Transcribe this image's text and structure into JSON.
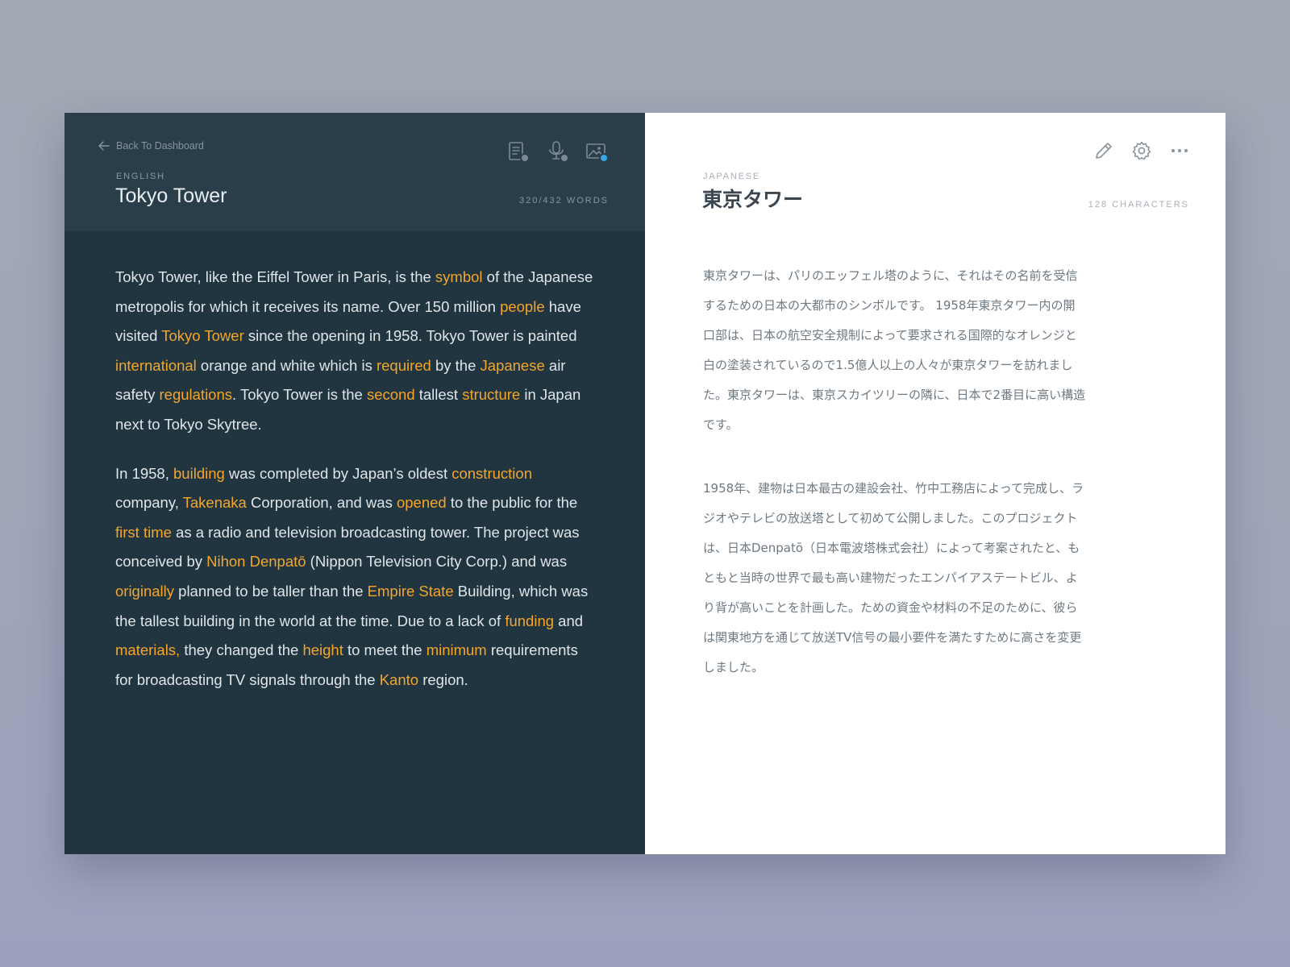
{
  "source": {
    "back_label": "Back To Dashboard",
    "language": "English",
    "title": "Tokyo Tower",
    "word_count": "320/432 WORDS",
    "tools": [
      {
        "icon": "document-check-icon",
        "badge": "check"
      },
      {
        "icon": "microphone-check-icon",
        "badge": "check"
      },
      {
        "icon": "image-check-icon",
        "badge": "check-blue"
      }
    ],
    "paragraphs": [
      [
        {
          "t": "Tokyo Tower, like the Eiffel Tower in Paris, is the "
        },
        {
          "t": "symbol",
          "hl": true
        },
        {
          "t": " of the Japanese metropolis for which it receives its name. Over 150 million "
        },
        {
          "t": "people",
          "hl": true
        },
        {
          "t": " have visited "
        },
        {
          "t": "Tokyo Tower",
          "hl": true
        },
        {
          "t": " since the opening in 1958. Tokyo Tower is painted "
        },
        {
          "t": "international",
          "hl": true
        },
        {
          "t": " orange and white which is "
        },
        {
          "t": "required",
          "hl": true
        },
        {
          "t": " by the "
        },
        {
          "t": "Japanese",
          "hl": true
        },
        {
          "t": " air safety "
        },
        {
          "t": "regulations",
          "hl": true
        },
        {
          "t": ". Tokyo Tower is the "
        },
        {
          "t": "second",
          "hl": true
        },
        {
          "t": " tallest "
        },
        {
          "t": "structure",
          "hl": true
        },
        {
          "t": " in Japan next to Tokyo Skytree."
        }
      ],
      [
        {
          "t": "In 1958, "
        },
        {
          "t": "building",
          "hl": true
        },
        {
          "t": " was completed by Japan’s oldest "
        },
        {
          "t": "construction",
          "hl": true
        },
        {
          "t": " company, "
        },
        {
          "t": "Takenaka",
          "hl": true
        },
        {
          "t": " Corporation, and was "
        },
        {
          "t": "opened",
          "hl": true
        },
        {
          "t": " to the public for the "
        },
        {
          "t": "first time",
          "hl": true
        },
        {
          "t": " as a radio and television broadcasting tower. The project was conceived by "
        },
        {
          "t": "Nihon Denpatō",
          "hl": true
        },
        {
          "t": " (Nippon Television City Corp.) and was "
        },
        {
          "t": "originally",
          "hl": true
        },
        {
          "t": " planned to be taller than the "
        },
        {
          "t": "Empire State",
          "hl": true
        },
        {
          "t": " Building, which was the tallest building in the world at the time. Due to a lack of "
        },
        {
          "t": "funding",
          "hl": true
        },
        {
          "t": " and "
        },
        {
          "t": "materials,",
          "hl": true
        },
        {
          "t": " they changed the "
        },
        {
          "t": "height",
          "hl": true
        },
        {
          "t": " to meet the "
        },
        {
          "t": "minimum",
          "hl": true
        },
        {
          "t": " requirements for broadcasting TV signals through the "
        },
        {
          "t": "Kanto",
          "hl": true
        },
        {
          "t": " region."
        }
      ]
    ]
  },
  "target": {
    "language": "Japanese",
    "title": "東京タワー",
    "char_count": "128 CHARACTERS",
    "tools": [
      "pencil-icon",
      "gear-icon",
      "more-icon"
    ],
    "paragraphs": [
      "東京タワーは、パリのエッフェル塔のように、それはその名前を受信するための日本の大都市のシンボルです。 1958年東京タワー内の開口部は、日本の航空安全規制によって要求される国際的なオレンジと白の塗装されているので1.5億人以上の人々が東京タワーを訪れました。東京タワーは、東京スカイツリーの隣に、日本で2番目に高い構造です。",
      "1958年、建物は日本最古の建設会社、竹中工務店によって完成し、ラジオやテレビの放送塔として初めて公開しました。このプロジェクトは、日本Denpatō（日本電波塔株式会社）によって考案されたと、もともと当時の世界で最も高い建物だったエンパイアステートビル、より背が高いことを計画した。ための資金や材料の不足のために、彼らは関東地方を通じて放送TV信号の最小要件を満たすために高さを変更しました。"
    ]
  },
  "colors": {
    "left_panel": "#213541",
    "left_header": "#2a3e4a",
    "highlight": "#f3a62a",
    "badge_blue": "#3aa7e8",
    "right_panel": "#ffffff"
  }
}
